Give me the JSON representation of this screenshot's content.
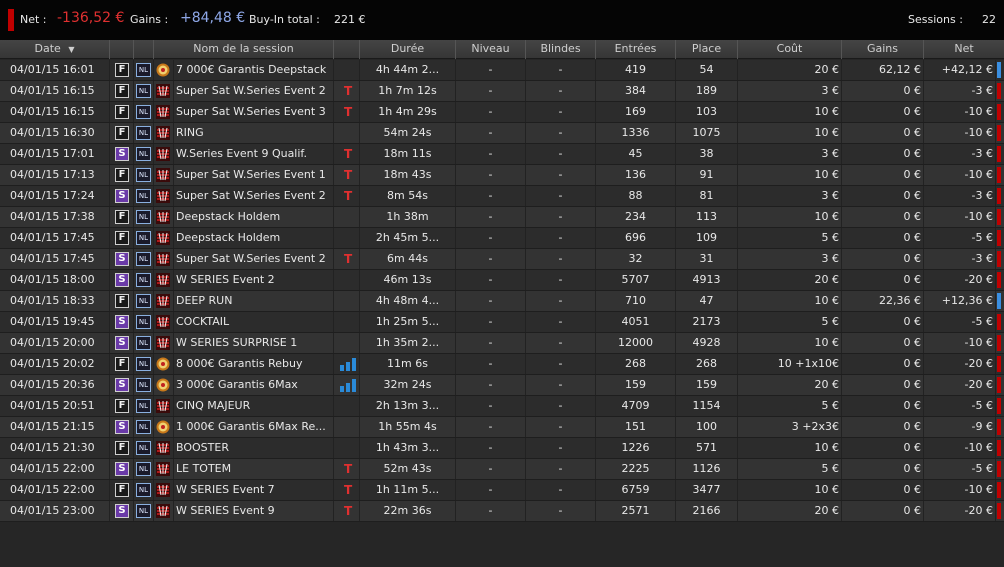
{
  "summary": {
    "net_label": "Net :",
    "net_value": "-136,52 €",
    "gains_label": "Gains :",
    "gains_value": "+84,48 €",
    "buyin_label": "Buy-In total :",
    "buyin_value": "221 €",
    "sessions_label": "Sessions :",
    "sessions_value": "22"
  },
  "columns": {
    "date": "Date",
    "name": "Nom de la session",
    "duration": "Durée",
    "level": "Niveau",
    "blinds": "Blindes",
    "entries": "Entrées",
    "place": "Place",
    "cost": "Coût",
    "gains": "Gains",
    "net": "Net"
  },
  "type_badges": {
    "F": "F",
    "S": "S",
    "NL": "NL"
  },
  "colors": {
    "negative": "#e03030",
    "positive": "#8fa8e8",
    "indicator_win": "#3a8ee0",
    "indicator_loss": "#c00000",
    "satellite_badge": "#6a3aa8"
  },
  "rows": [
    {
      "date": "04/01/15 16:01",
      "type": "F",
      "room": "coin-icon",
      "name": "7 000€ Garantis Deepstack",
      "tag": "",
      "duration": "4h 44m 2...",
      "level": "-",
      "blinds": "-",
      "entries": "419",
      "place": "54",
      "cost": "20 €",
      "gains": "62,12 €",
      "net": "+42,12 €",
      "win": true
    },
    {
      "date": "04/01/15 16:15",
      "type": "F",
      "room": "ws-icon",
      "name": "Super Sat W.Series Event 2",
      "tag": "T",
      "duration": "1h 7m 12s",
      "level": "-",
      "blinds": "-",
      "entries": "384",
      "place": "189",
      "cost": "3 €",
      "gains": "0 €",
      "net": "-3 €",
      "win": false
    },
    {
      "date": "04/01/15 16:15",
      "type": "F",
      "room": "ws-icon",
      "name": "Super Sat W.Series Event 3",
      "tag": "T",
      "duration": "1h 4m 29s",
      "level": "-",
      "blinds": "-",
      "entries": "169",
      "place": "103",
      "cost": "10 €",
      "gains": "0 €",
      "net": "-10 €",
      "win": false
    },
    {
      "date": "04/01/15 16:30",
      "type": "F",
      "room": "ws-icon",
      "name": "RING",
      "tag": "",
      "duration": "54m 24s",
      "level": "-",
      "blinds": "-",
      "entries": "1336",
      "place": "1075",
      "cost": "10 €",
      "gains": "0 €",
      "net": "-10 €",
      "win": false
    },
    {
      "date": "04/01/15 17:01",
      "type": "S",
      "room": "ws-icon",
      "name": "W.Series Event 9 Qualif.",
      "tag": "T",
      "duration": "18m 11s",
      "level": "-",
      "blinds": "-",
      "entries": "45",
      "place": "38",
      "cost": "3 €",
      "gains": "0 €",
      "net": "-3 €",
      "win": false
    },
    {
      "date": "04/01/15 17:13",
      "type": "F",
      "room": "ws-icon",
      "name": "Super Sat W.Series Event 1",
      "tag": "T",
      "duration": "18m 43s",
      "level": "-",
      "blinds": "-",
      "entries": "136",
      "place": "91",
      "cost": "10 €",
      "gains": "0 €",
      "net": "-10 €",
      "win": false
    },
    {
      "date": "04/01/15 17:24",
      "type": "S",
      "room": "ws-icon",
      "name": "Super Sat W.Series Event 2",
      "tag": "T",
      "duration": "8m 54s",
      "level": "-",
      "blinds": "-",
      "entries": "88",
      "place": "81",
      "cost": "3 €",
      "gains": "0 €",
      "net": "-3 €",
      "win": false
    },
    {
      "date": "04/01/15 17:38",
      "type": "F",
      "room": "ws-icon",
      "name": "Deepstack Holdem",
      "tag": "",
      "duration": "1h 38m",
      "level": "-",
      "blinds": "-",
      "entries": "234",
      "place": "113",
      "cost": "10 €",
      "gains": "0 €",
      "net": "-10 €",
      "win": false
    },
    {
      "date": "04/01/15 17:45",
      "type": "F",
      "room": "ws-icon",
      "name": "Deepstack Holdem",
      "tag": "",
      "duration": "2h 45m 5...",
      "level": "-",
      "blinds": "-",
      "entries": "696",
      "place": "109",
      "cost": "5 €",
      "gains": "0 €",
      "net": "-5 €",
      "win": false
    },
    {
      "date": "04/01/15 17:45",
      "type": "S",
      "room": "ws-icon",
      "name": "Super Sat W.Series Event 2",
      "tag": "T",
      "duration": "6m 44s",
      "level": "-",
      "blinds": "-",
      "entries": "32",
      "place": "31",
      "cost": "3 €",
      "gains": "0 €",
      "net": "-3 €",
      "win": false
    },
    {
      "date": "04/01/15 18:00",
      "type": "S",
      "room": "ws-icon",
      "name": "W SERIES Event 2",
      "tag": "",
      "duration": "46m 13s",
      "level": "-",
      "blinds": "-",
      "entries": "5707",
      "place": "4913",
      "cost": "20 €",
      "gains": "0 €",
      "net": "-20 €",
      "win": false
    },
    {
      "date": "04/01/15 18:33",
      "type": "F",
      "room": "ws-icon",
      "name": "DEEP RUN",
      "tag": "",
      "duration": "4h 48m 4...",
      "level": "-",
      "blinds": "-",
      "entries": "710",
      "place": "47",
      "cost": "10 €",
      "gains": "22,36 €",
      "net": "+12,36 €",
      "win": true
    },
    {
      "date": "04/01/15 19:45",
      "type": "S",
      "room": "ws-icon",
      "name": "COCKTAIL",
      "tag": "",
      "duration": "1h 25m 5...",
      "level": "-",
      "blinds": "-",
      "entries": "4051",
      "place": "2173",
      "cost": "5 €",
      "gains": "0 €",
      "net": "-5 €",
      "win": false
    },
    {
      "date": "04/01/15 20:00",
      "type": "S",
      "room": "ws-icon",
      "name": "W SERIES SURPRISE 1",
      "tag": "",
      "duration": "1h 35m 2...",
      "level": "-",
      "blinds": "-",
      "entries": "12000",
      "place": "4928",
      "cost": "10 €",
      "gains": "0 €",
      "net": "-10 €",
      "win": false
    },
    {
      "date": "04/01/15 20:02",
      "type": "F",
      "room": "coin-icon",
      "name": "8 000€ Garantis Rebuy",
      "tag": "bars",
      "duration": "11m 6s",
      "level": "-",
      "blinds": "-",
      "entries": "268",
      "place": "268",
      "cost": "10  +1x10€",
      "gains": "0 €",
      "net": "-20 €",
      "win": false
    },
    {
      "date": "04/01/15 20:36",
      "type": "S",
      "room": "coin-icon",
      "name": "3 000€ Garantis 6Max",
      "tag": "bars",
      "duration": "32m 24s",
      "level": "-",
      "blinds": "-",
      "entries": "159",
      "place": "159",
      "cost": "20 €",
      "gains": "0 €",
      "net": "-20 €",
      "win": false
    },
    {
      "date": "04/01/15 20:51",
      "type": "F",
      "room": "ws-icon",
      "name": "CINQ MAJEUR",
      "tag": "",
      "duration": "2h 13m 3...",
      "level": "-",
      "blinds": "-",
      "entries": "4709",
      "place": "1154",
      "cost": "5 €",
      "gains": "0 €",
      "net": "-5 €",
      "win": false
    },
    {
      "date": "04/01/15 21:15",
      "type": "S",
      "room": "coin-icon",
      "name": "1 000€ Garantis 6Max Re...",
      "tag": "",
      "duration": "1h 55m 4s",
      "level": "-",
      "blinds": "-",
      "entries": "151",
      "place": "100",
      "cost": "3  +2x3€",
      "gains": "0 €",
      "net": "-9 €",
      "win": false
    },
    {
      "date": "04/01/15 21:30",
      "type": "F",
      "room": "ws-icon",
      "name": "BOOSTER",
      "tag": "",
      "duration": "1h 43m 3...",
      "level": "-",
      "blinds": "-",
      "entries": "1226",
      "place": "571",
      "cost": "10 €",
      "gains": "0 €",
      "net": "-10 €",
      "win": false
    },
    {
      "date": "04/01/15 22:00",
      "type": "S",
      "room": "ws-icon",
      "name": "LE TOTEM",
      "tag": "T",
      "duration": "52m 43s",
      "level": "-",
      "blinds": "-",
      "entries": "2225",
      "place": "1126",
      "cost": "5 €",
      "gains": "0 €",
      "net": "-5 €",
      "win": false
    },
    {
      "date": "04/01/15 22:00",
      "type": "F",
      "room": "ws-icon",
      "name": "W SERIES Event 7",
      "tag": "T",
      "duration": "1h 11m 5...",
      "level": "-",
      "blinds": "-",
      "entries": "6759",
      "place": "3477",
      "cost": "10 €",
      "gains": "0 €",
      "net": "-10 €",
      "win": false
    },
    {
      "date": "04/01/15 23:00",
      "type": "S",
      "room": "ws-icon",
      "name": "W SERIES Event 9",
      "tag": "T",
      "duration": "22m 36s",
      "level": "-",
      "blinds": "-",
      "entries": "2571",
      "place": "2166",
      "cost": "20 €",
      "gains": "0 €",
      "net": "-20 €",
      "win": false
    }
  ]
}
